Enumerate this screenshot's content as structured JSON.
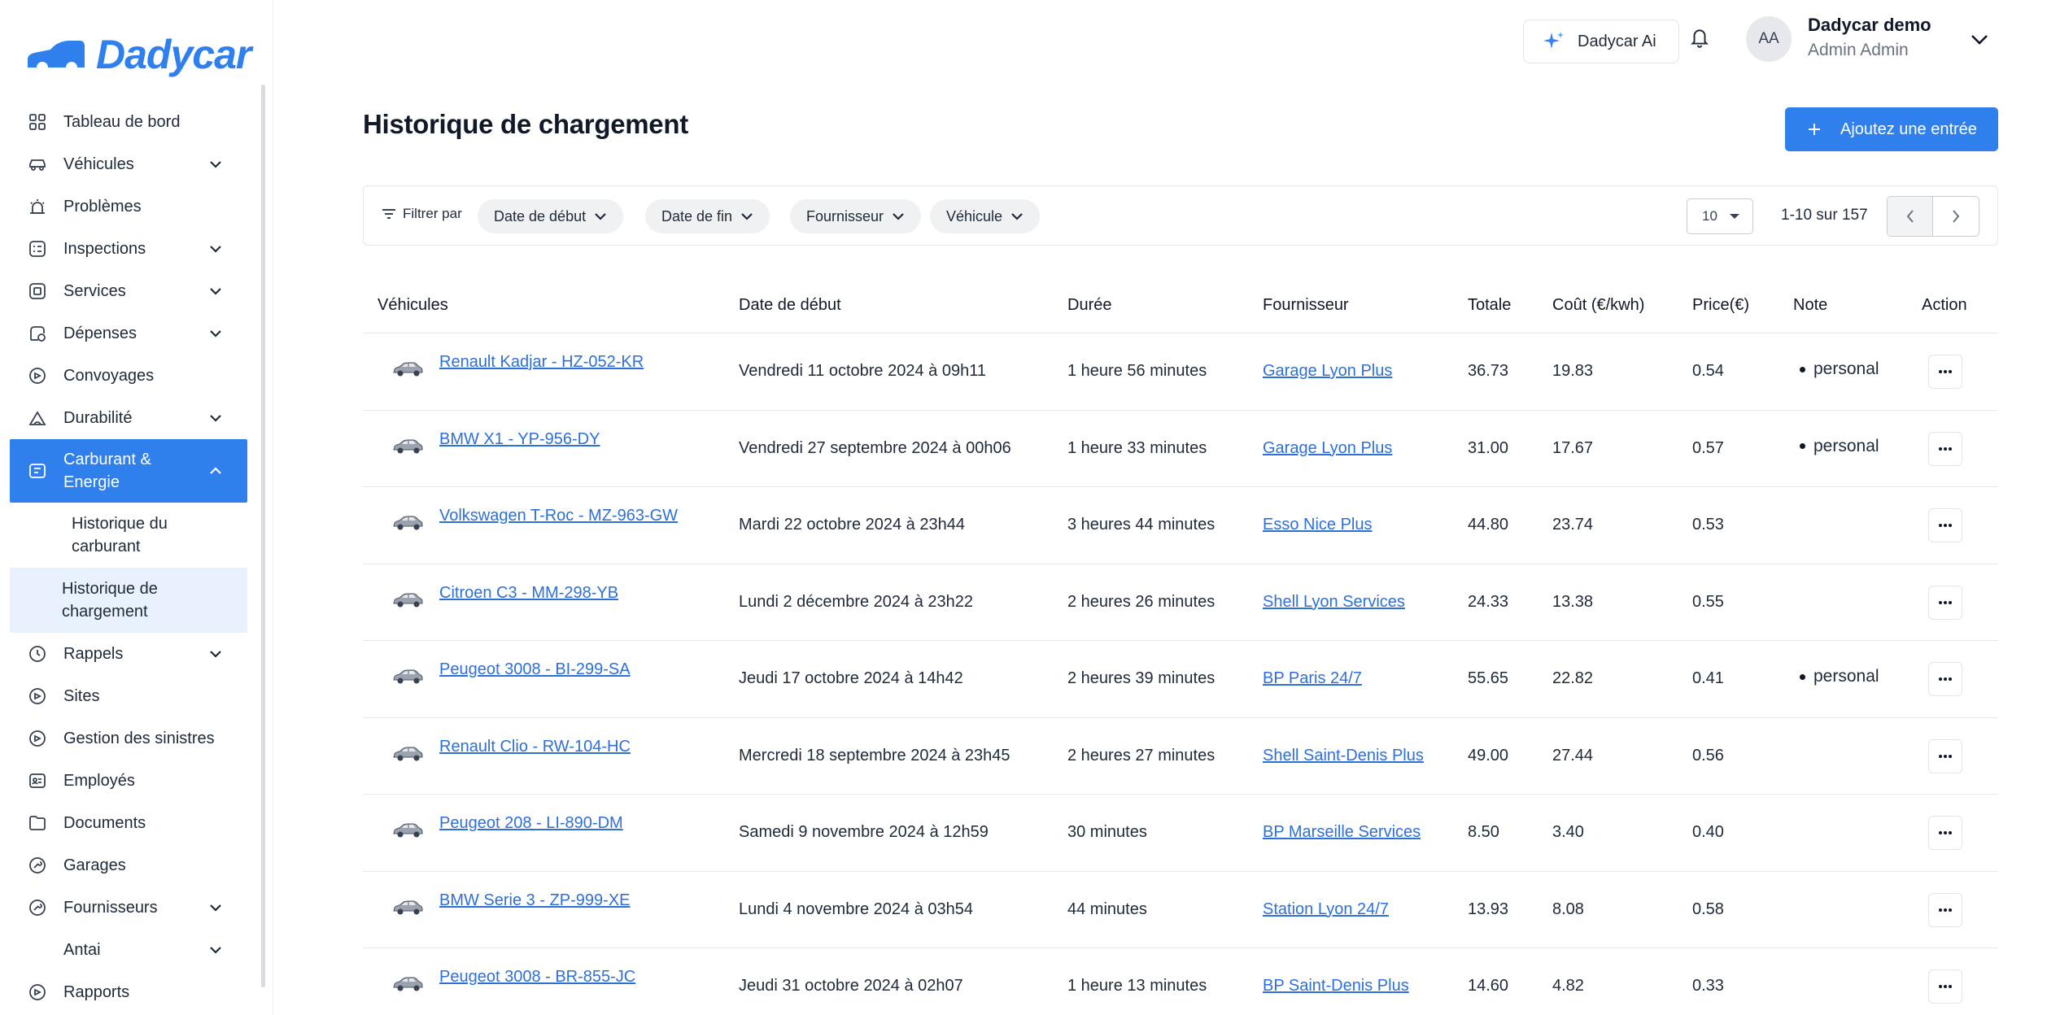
{
  "brand": {
    "name": "Dadycar",
    "color": "#2f80ed"
  },
  "sidebar": {
    "items": [
      {
        "label": "Tableau de bord",
        "icon": "dashboard-icon",
        "expandable": false
      },
      {
        "label": "Véhicules",
        "icon": "car-icon",
        "expandable": true
      },
      {
        "label": "Problèmes",
        "icon": "alarm-icon",
        "expandable": false
      },
      {
        "label": "Inspections",
        "icon": "inspection-icon",
        "expandable": true
      },
      {
        "label": "Services",
        "icon": "service-icon",
        "expandable": true
      },
      {
        "label": "Dépenses",
        "icon": "expense-icon",
        "expandable": true
      },
      {
        "label": "Convoyages",
        "icon": "convoy-icon",
        "expandable": false
      },
      {
        "label": "Durabilité",
        "icon": "leaf-icon",
        "expandable": true
      },
      {
        "label": "Carburant & Energie",
        "icon": "fuel-icon",
        "expandable": true,
        "active": true
      },
      {
        "label": "Rappels",
        "icon": "clock-icon",
        "expandable": true
      },
      {
        "label": "Sites",
        "icon": "sites-icon",
        "expandable": false
      },
      {
        "label": "Gestion des sinistres",
        "icon": "claims-icon",
        "expandable": false
      },
      {
        "label": "Employés",
        "icon": "employees-icon",
        "expandable": false
      },
      {
        "label": "Documents",
        "icon": "documents-icon",
        "expandable": false
      },
      {
        "label": "Garages",
        "icon": "garage-icon",
        "expandable": false
      },
      {
        "label": "Fournisseurs",
        "icon": "suppliers-icon",
        "expandable": true
      },
      {
        "label": "Antai",
        "icon": "",
        "expandable": true
      },
      {
        "label": "Rapports",
        "icon": "reports-icon",
        "expandable": false
      }
    ],
    "sub_items": [
      {
        "label": "Historique du carburant",
        "selected": false
      },
      {
        "label": "Historique de chargement",
        "selected": true
      }
    ]
  },
  "topbar": {
    "ai_label": "Dadycar Ai",
    "avatar_initials": "AA",
    "user_name": "Dadycar demo",
    "user_role": "Admin Admin"
  },
  "page": {
    "title": "Historique de chargement",
    "add_label": "Ajoutez une entrée"
  },
  "filters": {
    "label": "Filtrer par",
    "chips": [
      "Date de début",
      "Date de fin",
      "Fournisseur",
      "Véhicule"
    ],
    "page_size": "10",
    "page_info": "1-10 sur 157"
  },
  "table": {
    "headers": [
      "Véhicules",
      "Date de début",
      "Durée",
      "Fournisseur",
      "Totale",
      "Coût (€/kwh)",
      "Price(€)",
      "Note",
      "Action"
    ],
    "rows": [
      {
        "vehicle": "Renault Kadjar - HZ-052-KR",
        "start": "Vendredi 11 octobre 2024 à 09h11",
        "duration": "1 heure 56 minutes",
        "supplier": "Garage Lyon Plus",
        "total": "36.73",
        "cost": "19.83",
        "price": "0.54",
        "note": "personal"
      },
      {
        "vehicle": "BMW X1 - YP-956-DY",
        "start": "Vendredi 27 septembre 2024 à 00h06",
        "duration": "1 heure 33 minutes",
        "supplier": "Garage Lyon Plus",
        "total": "31.00",
        "cost": "17.67",
        "price": "0.57",
        "note": "personal"
      },
      {
        "vehicle": "Volkswagen T-Roc - MZ-963-GW",
        "start": "Mardi 22 octobre 2024 à 23h44",
        "duration": "3 heures 44 minutes",
        "supplier": "Esso Nice Plus",
        "total": "44.80",
        "cost": "23.74",
        "price": "0.53",
        "note": ""
      },
      {
        "vehicle": "Citroen C3 - MM-298-YB",
        "start": "Lundi 2 décembre 2024 à 23h22",
        "duration": "2 heures 26 minutes",
        "supplier": "Shell Lyon Services",
        "total": "24.33",
        "cost": "13.38",
        "price": "0.55",
        "note": ""
      },
      {
        "vehicle": "Peugeot 3008 - BI-299-SA",
        "start": "Jeudi 17 octobre 2024 à 14h42",
        "duration": "2 heures 39 minutes",
        "supplier": "BP Paris 24/7",
        "total": "55.65",
        "cost": "22.82",
        "price": "0.41",
        "note": "personal"
      },
      {
        "vehicle": "Renault Clio - RW-104-HC",
        "start": "Mercredi 18 septembre 2024 à 23h45",
        "duration": "2 heures 27 minutes",
        "supplier": "Shell Saint-Denis Plus",
        "total": "49.00",
        "cost": "27.44",
        "price": "0.56",
        "note": ""
      },
      {
        "vehicle": "Peugeot 208 - LI-890-DM",
        "start": "Samedi 9 novembre 2024 à 12h59",
        "duration": "30 minutes",
        "supplier": "BP Marseille Services",
        "total": "8.50",
        "cost": "3.40",
        "price": "0.40",
        "note": ""
      },
      {
        "vehicle": "BMW Serie 3 - ZP-999-XE",
        "start": "Lundi 4 novembre 2024 à 03h54",
        "duration": "44 minutes",
        "supplier": "Station Lyon 24/7",
        "total": "13.93",
        "cost": "8.08",
        "price": "0.58",
        "note": ""
      },
      {
        "vehicle": "Peugeot 3008 - BR-855-JC",
        "start": "Jeudi 31 octobre 2024 à 02h07",
        "duration": "1 heure 13 minutes",
        "supplier": "BP Saint-Denis Plus",
        "total": "14.60",
        "cost": "4.82",
        "price": "0.33",
        "note": ""
      }
    ]
  }
}
